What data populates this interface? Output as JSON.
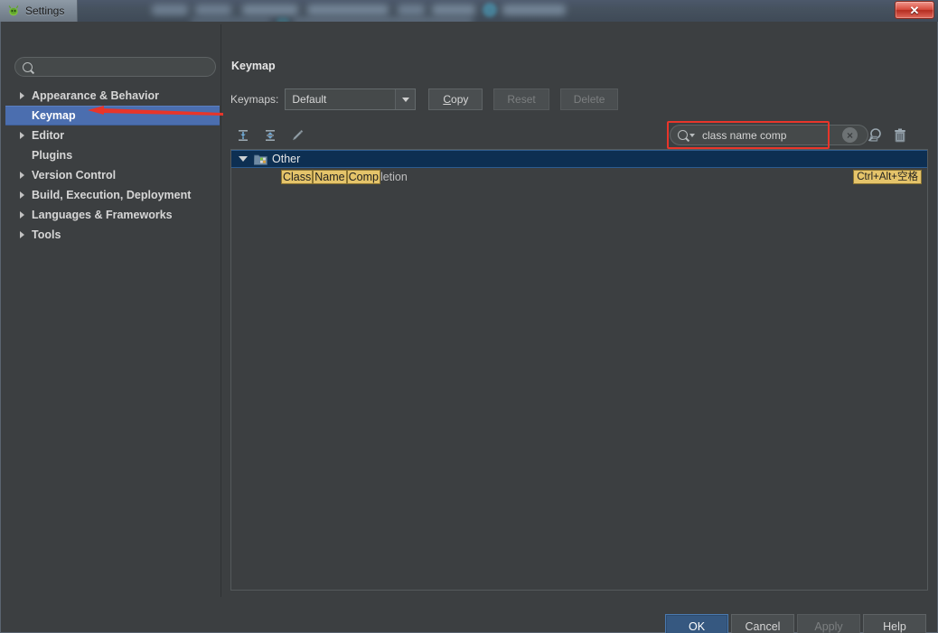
{
  "window": {
    "title": "Settings",
    "close_label": "✕",
    "app_icon": "intellij-icon",
    "accent_selected": "#4b6eaf",
    "accent_default_button": "#365880",
    "highlight_color": "#e5c46a",
    "annotation_color": "#e8352a"
  },
  "sidebar": {
    "search": {
      "value": "",
      "placeholder": "",
      "icon": "search-icon"
    },
    "items": [
      {
        "label": "Appearance & Behavior",
        "expandable": true,
        "selected": false
      },
      {
        "label": "Keymap",
        "expandable": false,
        "selected": true
      },
      {
        "label": "Editor",
        "expandable": true,
        "selected": false
      },
      {
        "label": "Plugins",
        "expandable": false,
        "selected": false
      },
      {
        "label": "Version Control",
        "expandable": true,
        "selected": false
      },
      {
        "label": "Build, Execution, Deployment",
        "expandable": true,
        "selected": false
      },
      {
        "label": "Languages & Frameworks",
        "expandable": true,
        "selected": false
      },
      {
        "label": "Tools",
        "expandable": true,
        "selected": false
      }
    ]
  },
  "main": {
    "title": "Keymap",
    "keymaps_label": "Keymaps:",
    "keymap_selected": "Default",
    "keymap_options": [
      "Default"
    ],
    "buttons": {
      "copy": "Copy",
      "copy_mnemonic": "C",
      "reset": "Reset",
      "reset_disabled": true,
      "delete": "Delete",
      "delete_disabled": true
    },
    "toolbar": [
      {
        "name": "expand-all-icon",
        "tooltip": "Expand All"
      },
      {
        "name": "collapse-all-icon",
        "tooltip": "Collapse All"
      },
      {
        "name": "edit-shortcut-icon",
        "tooltip": "Edit Shortcut"
      }
    ],
    "search": {
      "value": "class name comp",
      "icon": "search-dropdown-icon",
      "clear_icon": "clear-circle-icon",
      "clear_label": "×",
      "find_by_shortcut_icon": "find-by-shortcut-icon",
      "clear_filter_icon": "trash-icon"
    },
    "tree": {
      "group": {
        "label": "Other",
        "expanded": true,
        "selected": true,
        "icon": "folder-icon"
      },
      "rows": [
        {
          "parts": [
            {
              "text": "Class",
              "highlighted": true
            },
            {
              "text": "Name",
              "highlighted": true
            },
            {
              "text": "Comp",
              "highlighted": true
            },
            {
              "text": "letion",
              "highlighted": false
            }
          ],
          "shortcut": "Ctrl+Alt+空格",
          "shortcut_highlighted": true
        }
      ]
    }
  },
  "footer": {
    "ok": "OK",
    "cancel": "Cancel",
    "apply": "Apply",
    "apply_disabled": true,
    "help": "Help"
  }
}
